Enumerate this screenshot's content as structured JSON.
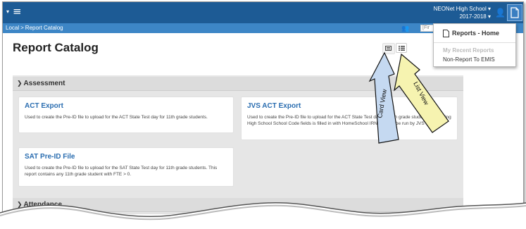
{
  "topbar": {
    "school_name": "NEONet High School",
    "year": "2017-2018"
  },
  "breadcrumb": {
    "root": "Local",
    "separator": ">",
    "current": "Report Catalog"
  },
  "find": {
    "placeholder": "[Fir"
  },
  "page": {
    "title": "Report Catalog"
  },
  "dropdown": {
    "home_label": "Reports - Home",
    "recent_heading": "My Recent Reports",
    "recent_item": "Non-Report To EMIS"
  },
  "sections": [
    {
      "title": "Assessment",
      "cards": [
        {
          "title": "ACT Export",
          "description": "Used to create the Pre-ID file to upload for the ACT State Test day for 11th grade students."
        },
        {
          "title": "JVS ACT Export",
          "description": "Used to create the Pre-ID file to upload for the ACT State Test day for 11th grade students. Reporting High School School Code fields is filled in with HomeSchool IRN field. To be run by JVS Schools."
        },
        {
          "title": "SAT Pre-ID File",
          "description": "Used to create the Pre-ID file to upload for the SAT State Test day for 11th grade students. This report contains any 11th grade student with FTE > 0."
        }
      ]
    },
    {
      "title": "Attendance",
      "cards": []
    }
  ],
  "annotations": {
    "card_view": "Card View",
    "list_view": "List View",
    "card_color": "#c5d9f1",
    "list_color": "#f6f3b0"
  }
}
